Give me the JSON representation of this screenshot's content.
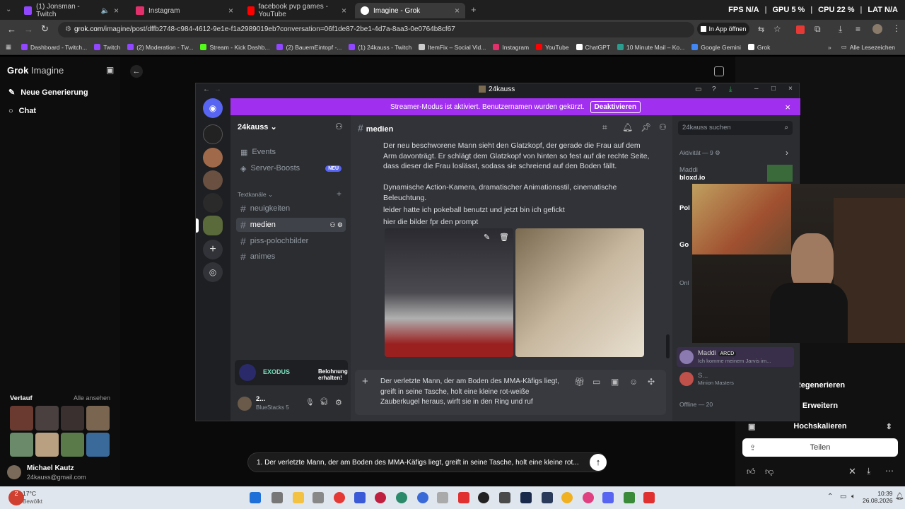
{
  "browser": {
    "tabs": [
      {
        "label": "(1) Jonsman - Twitch",
        "color": "#9146ff"
      },
      {
        "label": "Instagram",
        "color": "#e1306c"
      },
      {
        "label": "facebook pvp games - YouTube",
        "color": "#ff0000"
      },
      {
        "label": "Imagine - Grok",
        "color": "#ffffff"
      }
    ],
    "stats": {
      "fps_label": "FPS",
      "fps": "N/A",
      "gpu_label": "GPU",
      "gpu": "5 %",
      "cpu_label": "CPU",
      "cpu": "22 %",
      "lat_label": "LAT",
      "lat": "N/A"
    },
    "url_host": "grok.com",
    "url_path": "/imagine/post/dffb2748-c984-4612-9e1e-f1a2989019eb?conversation=06f1de87-2be1-4d7a-8aa3-0e0764b8cf67",
    "in_app": "In App öffnen",
    "bookmarks": [
      {
        "label": "Dashboard - Twitch...",
        "color": "#9146ff"
      },
      {
        "label": "Twitch",
        "color": "#9146ff"
      },
      {
        "label": "(2) Moderation - Tw...",
        "color": "#9146ff"
      },
      {
        "label": "Stream - Kick Dashb...",
        "color": "#53fc18"
      },
      {
        "label": "(2) BauernEintopf -...",
        "color": "#9146ff"
      },
      {
        "label": "(1) 24kauss - Twitch",
        "color": "#9146ff"
      },
      {
        "label": "ItemFix – Social Vid...",
        "color": "#cccccc"
      },
      {
        "label": "Instagram",
        "color": "#e1306c"
      },
      {
        "label": "YouTube",
        "color": "#ff0000"
      },
      {
        "label": "ChatGPT",
        "color": "#ffffff"
      },
      {
        "label": "10 Minute Mail – Ko...",
        "color": "#2a9d8f"
      },
      {
        "label": "Google Gemini",
        "color": "#4285f4"
      },
      {
        "label": "Grok",
        "color": "#ffffff"
      }
    ],
    "all_bookmarks": "Alle Lesezeichen"
  },
  "grok": {
    "logo": "Grok",
    "logo_sub": "Imagine",
    "new_gen": "Neue Generierung",
    "chat": "Chat",
    "history": "Verlauf",
    "show_all": "Alle ansehen",
    "user_name": "Michael Kautz",
    "user_email": "24kauss@gmail.com",
    "prompt_text": "1. Der verletzte Mann, der am Boden des MMA-Käfigs liegt, greift in seine Tasche, holt eine kleine rot...",
    "actions": [
      "Regenerieren",
      "Erweitern",
      "Hochskalieren",
      "Teilen"
    ]
  },
  "discord": {
    "window_title": "24kauss",
    "streamer_text": "Streamer-Modus ist aktiviert. Benutzernamen wurden gekürzt.",
    "streamer_btn": "Deaktivieren",
    "server_name": "24kauss",
    "events": "Events",
    "boosts": "Server-Boosts",
    "new_badge": "NEU",
    "text_channels": "Textkanäle",
    "channels": [
      "neuigkeiten",
      "medien",
      "piss-polochbilder",
      "animes"
    ],
    "current_channel": "medien",
    "search_placeholder": "24kauss suchen",
    "messages": [
      "Der neu beschworene Mann sieht den Glatzkopf, der gerade die Frau auf dem Arm davonträgt. Er schlägt dem Glatzkopf von hinten so fest auf die rechte Seite, dass dieser die Frau loslässt, sodass sie schreiend auf den Boden fällt.",
      "Dynamische Action-Kamera, dramatischer Animationsstil, cinematische Beleuchtung.",
      "leider hatte ich pokeball benutzt und jetzt bin ich gefickt",
      "hier die bilder fpr den prompt"
    ],
    "composer_text": "Der verletzte Mann, der am Boden des MMA-Käfigs liegt, greift in seine Tasche, holt eine kleine rot-weiße Zauberkugel heraus, wirft sie in den Ring und ruf",
    "promo_brand": "EXODUS",
    "promo_btn": "Belohnung erhalten!",
    "self_name": "2...",
    "self_status": "BlueStacks 5",
    "activity": "Aktivität — 9",
    "members": [
      {
        "name": "Maddi",
        "sub": "bloxd.io"
      },
      {
        "name": "Pol",
        "sub": ""
      },
      {
        "name": "Go",
        "sub": ""
      },
      {
        "name": "Maddi",
        "sub": "Ich komme meinem Jarvis im..."
      },
      {
        "name": "S...",
        "sub": "Minion Masters"
      }
    ],
    "maddi_tag": "ARCD",
    "offline": "Offline — 20",
    "online_short": "Onl"
  },
  "taskbar": {
    "weather_temp": "17°C",
    "weather_text": "Bewölkt",
    "notif_count": "2",
    "time": "10:39",
    "date": "26.08.2026"
  }
}
